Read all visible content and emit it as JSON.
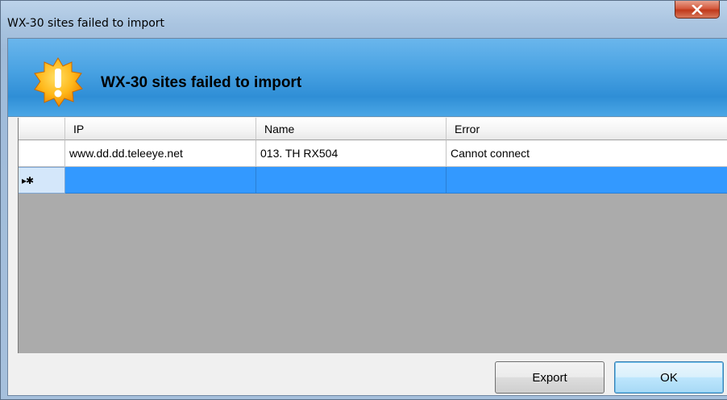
{
  "window": {
    "title": "WX-30 sites failed to import"
  },
  "header": {
    "title": "WX-30 sites failed to import",
    "icon": "warning-burst-icon",
    "accent_color": "#3a98e0"
  },
  "grid": {
    "columns": [
      "IP",
      "Name",
      "Error"
    ],
    "rows": [
      {
        "ip": "www.dd.dd.teleeye.net",
        "name": "013. TH RX504",
        "error": "Cannot connect"
      }
    ],
    "new_row_marker": "▸✱",
    "selection_color": "#3399ff"
  },
  "buttons": {
    "export_label": "Export",
    "ok_label": "OK"
  }
}
